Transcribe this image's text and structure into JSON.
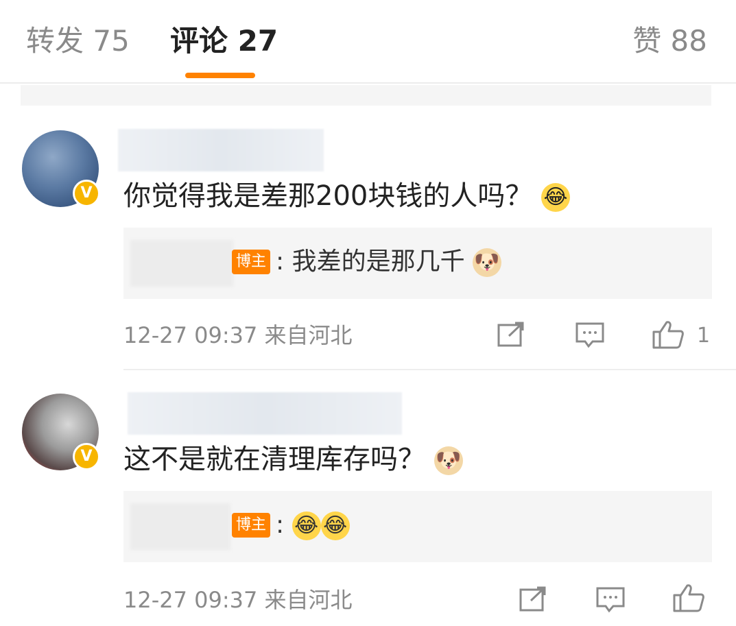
{
  "tabs": {
    "repost": "转发 75",
    "comments": "评论 27",
    "likes": "赞 88"
  },
  "accent_color": "#ff8200",
  "comments": [
    {
      "verified_badge": "V",
      "text": "你觉得我是差那200块钱的人吗？",
      "emoji": "laughing-tears-emoji",
      "reply": {
        "tag": "博主",
        "text": ": 我差的是那几千",
        "emoji": "doge-emoji"
      },
      "time": "12-27 09:37",
      "location": "来自河北",
      "like_count": "1"
    },
    {
      "verified_badge": "V",
      "text": "这不是就在清理库存吗？",
      "emoji": "doge-emoji",
      "reply": {
        "tag": "博主",
        "text": ":",
        "emojis": [
          "grin-emoji",
          "grin-emoji"
        ]
      },
      "time": "12-27 09:37",
      "location": "来自河北",
      "like_count": ""
    }
  ]
}
